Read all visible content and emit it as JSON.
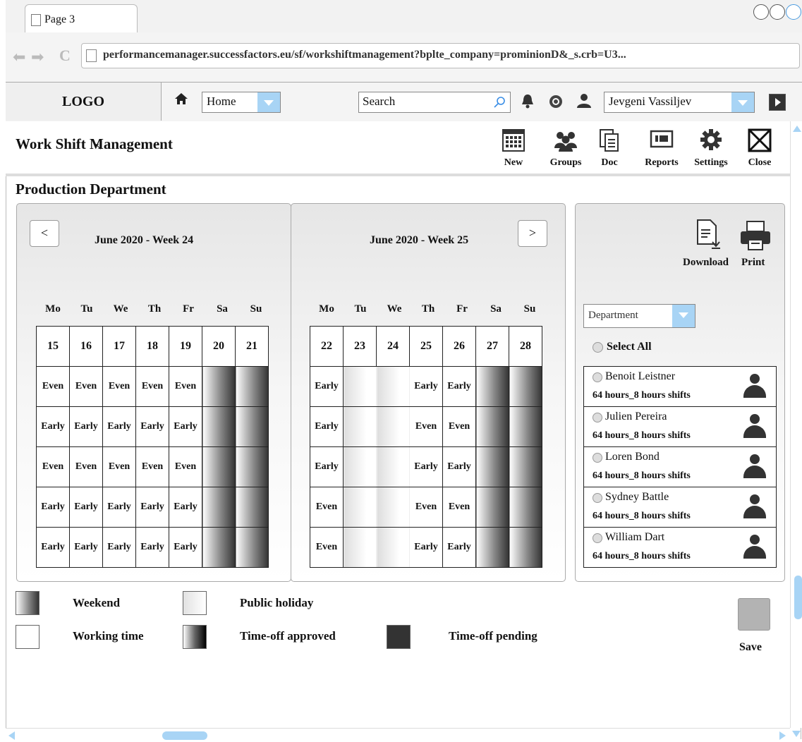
{
  "browser": {
    "tab_title": "Page 3",
    "url": "performancemanager.successfactors.eu/sf/workshiftmanagement?bplte_company=prominionD&_s.crb=U3..."
  },
  "header": {
    "logo": "LOGO",
    "home_select": "Home",
    "search_placeholder": "Search",
    "user_select": "Jevgeni Vassiljev"
  },
  "page": {
    "title": "Work Shift Management",
    "toolbar": [
      "New",
      "Groups",
      "Doc",
      "Reports",
      "Settings",
      "Close"
    ],
    "department": "Production Department"
  },
  "calendar": {
    "weekday_labels": [
      "Mo",
      "Tu",
      "We",
      "Th",
      "Fr",
      "Sa",
      "Su"
    ],
    "prev_label": "<",
    "next_label": ">",
    "weeks": [
      {
        "title": "June 2020 - Week 24",
        "dates": [
          "15",
          "16",
          "17",
          "18",
          "19",
          "20",
          "21"
        ],
        "rows": [
          [
            "Even",
            "Even",
            "Even",
            "Even",
            "Even",
            "",
            ""
          ],
          [
            "Early",
            "Early",
            "Early",
            "Early",
            "Early",
            "",
            ""
          ],
          [
            "Even",
            "Even",
            "Even",
            "Even",
            "Even",
            "",
            ""
          ],
          [
            "Early",
            "Early",
            "Early",
            "Early",
            "Early",
            "",
            ""
          ],
          [
            "Early",
            "Early",
            "Early",
            "Early",
            "Early",
            "",
            ""
          ]
        ]
      },
      {
        "title": "June 2020 - Week 25",
        "dates": [
          "22",
          "23",
          "24",
          "25",
          "26",
          "27",
          "28"
        ],
        "rows": [
          [
            "Early",
            "",
            "",
            "Early",
            "Early",
            "",
            ""
          ],
          [
            "Early",
            "",
            "",
            "Even",
            "Even",
            "",
            ""
          ],
          [
            "Early",
            "",
            "",
            "Early",
            "Early",
            "",
            ""
          ],
          [
            "Even",
            "",
            "",
            "Even",
            "Even",
            "",
            ""
          ],
          [
            "Even",
            "",
            "",
            "Early",
            "Early",
            "",
            ""
          ]
        ]
      }
    ]
  },
  "side": {
    "download": "Download",
    "print": "Print",
    "department_select": "Department",
    "select_all": "Select All",
    "employees": [
      {
        "name": "Benoit Leistner",
        "hours": "64 hours_8 hours shifts"
      },
      {
        "name": "Julien Pereira",
        "hours": "64 hours_8 hours shifts"
      },
      {
        "name": "Loren Bond",
        "hours": "64 hours_8 hours shifts"
      },
      {
        "name": "Sydney Battle",
        "hours": "64 hours_8 hours shifts"
      },
      {
        "name": "William Dart",
        "hours": "64 hours_8 hours shifts"
      }
    ]
  },
  "legend": {
    "weekend": "Weekend",
    "public_holiday": "Public holiday",
    "working_time": "Working time",
    "timeoff_approved": "Time-off approved",
    "timeoff_pending": "Time-off pending"
  },
  "save_label": "Save"
}
